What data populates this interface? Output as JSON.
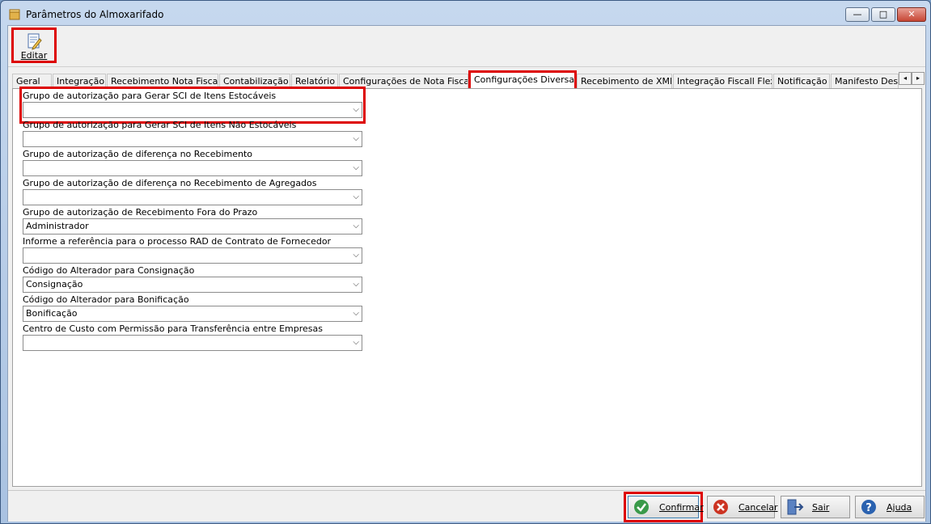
{
  "window": {
    "title": "Parâmetros do Almoxarifado",
    "min_label": "—",
    "max_label": "□",
    "close_label": "✕"
  },
  "toolbar": {
    "edit_label": "Editar"
  },
  "tabs": [
    {
      "label": "Geral"
    },
    {
      "label": "Integração"
    },
    {
      "label": "Recebimento Nota Fiscal"
    },
    {
      "label": "Contabilização"
    },
    {
      "label": "Relatório"
    },
    {
      "label": "Configurações de Nota Fiscal"
    },
    {
      "label": "Configurações Diversas",
      "active": true
    },
    {
      "label": "Recebimento de XML"
    },
    {
      "label": "Integração Fiscall Flex"
    },
    {
      "label": "Notificação"
    },
    {
      "label": "Manifesto Dest"
    }
  ],
  "tab_scroll": {
    "left": "◂",
    "right": "▸"
  },
  "fields": [
    {
      "label": "Grupo de autorização para Gerar SCI de Itens Estocáveis",
      "value": ""
    },
    {
      "label": "Grupo de autorização para Gerar SCI de Itens Não Estocáveis",
      "value": ""
    },
    {
      "label": "Grupo de autorização de diferença no Recebimento",
      "value": ""
    },
    {
      "label": "Grupo de autorização de diferença no Recebimento de Agregados",
      "value": ""
    },
    {
      "label": "Grupo de autorização de Recebimento Fora do Prazo",
      "value": "Administrador"
    },
    {
      "label": "Informe a referência para o processo RAD de Contrato de Fornecedor",
      "value": ""
    },
    {
      "label": "Código do Alterador para Consignação",
      "value": "Consignação"
    },
    {
      "label": "Código do Alterador para Bonificação",
      "value": "Bonificação"
    },
    {
      "label": "Centro de Custo com Permissão para Transferência entre Empresas",
      "value": ""
    }
  ],
  "combo_arrow": "⌵",
  "buttons": {
    "confirm": "Confirmar",
    "cancel": "Cancelar",
    "exit": "Sair",
    "help": "Ajuda"
  },
  "colors": {
    "highlight": "#d00000",
    "confirm_icon": "#3a9a4a",
    "cancel_icon": "#cc3322",
    "help_icon": "#2a62b0"
  }
}
